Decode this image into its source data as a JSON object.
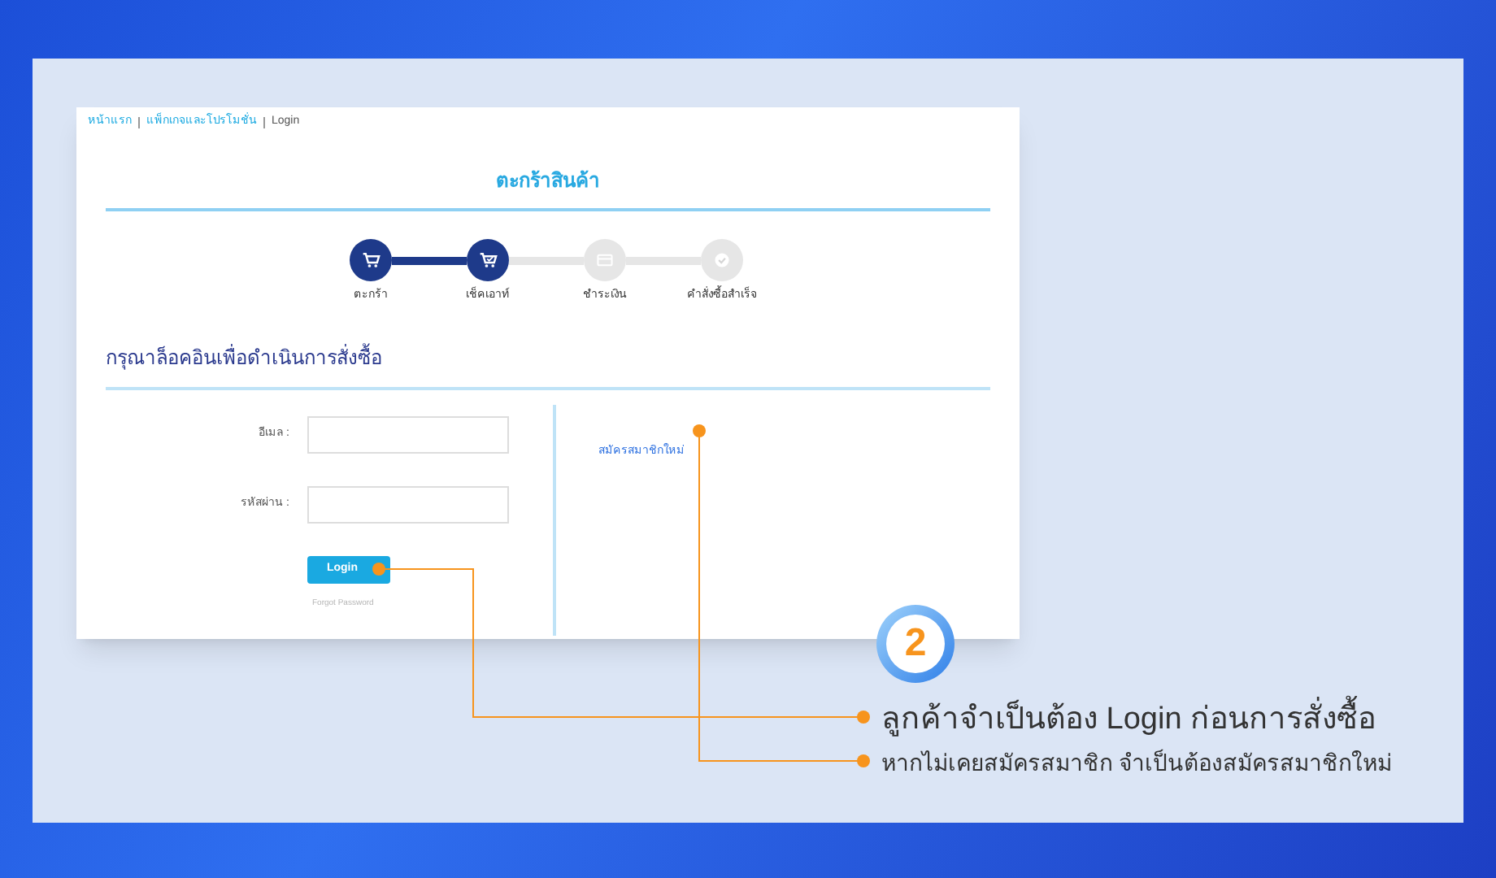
{
  "breadcrumb": [
    {
      "label": "หน้าแรก",
      "current": false
    },
    {
      "label": "แพ็กเกจและโปรโมชั่น",
      "current": false
    },
    {
      "label": "Login",
      "current": true
    }
  ],
  "page_title": "ตะกร้าสินค้า",
  "steps": [
    {
      "label": "ตะกร้า",
      "done": true,
      "kind": "cart"
    },
    {
      "label": "เช็คเอาท์",
      "done": true,
      "kind": "checkout"
    },
    {
      "label": "ชำระเงิน",
      "done": false,
      "kind": "card"
    },
    {
      "label": "คำสั่งซื้อสำเร็จ",
      "done": false,
      "kind": "check"
    }
  ],
  "login_heading": "กรุณาล็อคอินเพื่อดำเนินการสั่งซื้อ",
  "fields": [
    {
      "label": "อีเมล :"
    },
    {
      "label": "รหัสผ่าน :"
    }
  ],
  "login_button": "Login",
  "forgot_link": "Forgot Password",
  "register_link": "สมัครสมาชิกใหม่",
  "badge": "2",
  "callouts": [
    "ลูกค้าจำเป็นต้อง Login ก่อนการสั่งซื้อ",
    "หากไม่เคยสมัครสมาชิก จำเป็นต้องสมัครสมาชิกใหม่"
  ]
}
